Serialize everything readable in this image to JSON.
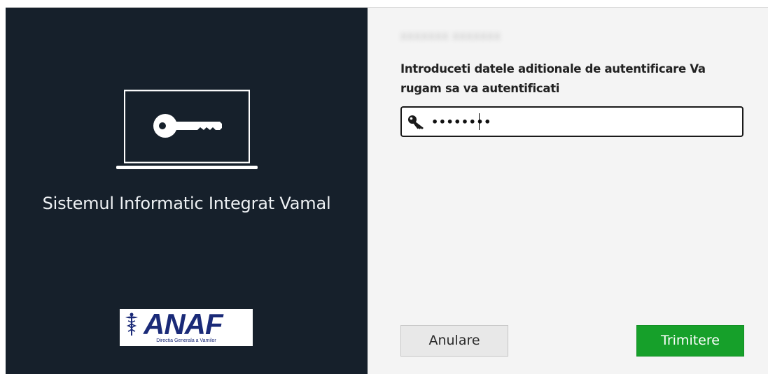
{
  "left_panel": {
    "system_title": "Sistemul Informatic Integrat Vamal",
    "illustration_icon": "laptop-key-icon",
    "logo": {
      "text": "ANAF",
      "subtitle": "Directia Generala a Vamilor",
      "icon": "caduceus-icon"
    }
  },
  "right_panel": {
    "blurred_username": "XXXXXXX XXXXXXX",
    "prompt_text": "Introduceti datele aditionale de autentificare Va rugam sa va autentificati",
    "password_field": {
      "icon": "key-icon",
      "value": "••••••••"
    },
    "buttons": {
      "cancel_label": "Anulare",
      "submit_label": "Trimitere"
    }
  },
  "colors": {
    "left_background": "#16202b",
    "right_background": "#f4f4f4",
    "submit_button": "#16a02a",
    "logo_blue": "#1a2a78"
  }
}
